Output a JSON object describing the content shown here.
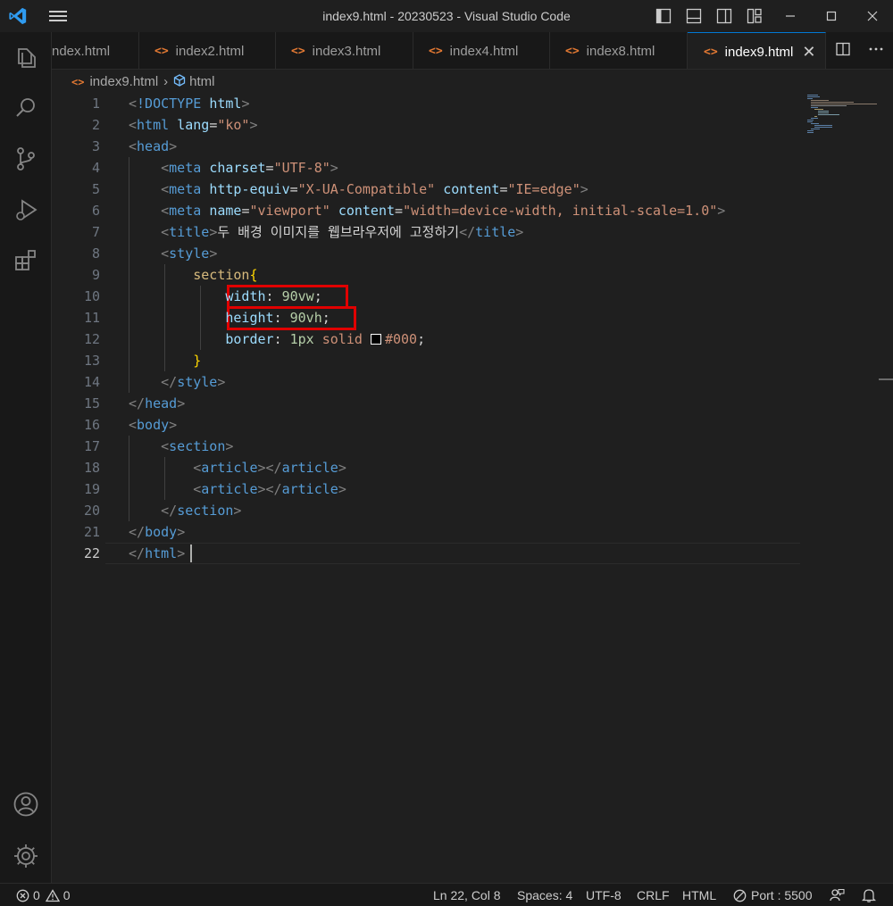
{
  "window": {
    "title": "index9.html - 20230523 - Visual Studio Code"
  },
  "tabs": [
    {
      "label": "index.html",
      "shown": "ndex.html",
      "active": false
    },
    {
      "label": "index2.html",
      "active": false
    },
    {
      "label": "index3.html",
      "active": false
    },
    {
      "label": "index4.html",
      "active": false
    },
    {
      "label": "index8.html",
      "active": false
    },
    {
      "label": "index9.html",
      "active": true
    }
  ],
  "tab_icon": "<>",
  "breadcrumb": {
    "file": "index9.html",
    "symbol": "html"
  },
  "editor": {
    "line_numbers": [
      "1",
      "2",
      "3",
      "4",
      "5",
      "6",
      "7",
      "8",
      "9",
      "10",
      "11",
      "12",
      "13",
      "14",
      "15",
      "16",
      "17",
      "18",
      "19",
      "20",
      "21",
      "22"
    ],
    "current_line": 22,
    "lines": [
      [
        [
          "p",
          "<"
        ],
        [
          "t",
          "!DOCTYPE"
        ],
        [
          "w",
          " "
        ],
        [
          "a",
          "html"
        ],
        [
          "p",
          ">"
        ]
      ],
      [
        [
          "p",
          "<"
        ],
        [
          "t",
          "html"
        ],
        [
          "w",
          " "
        ],
        [
          "a",
          "lang"
        ],
        [
          "w",
          "="
        ],
        [
          "s",
          "\"ko\""
        ],
        [
          "p",
          ">"
        ]
      ],
      [
        [
          "p",
          "<"
        ],
        [
          "t",
          "head"
        ],
        [
          "p",
          ">"
        ]
      ],
      [
        [
          "w",
          "    "
        ],
        [
          "p",
          "<"
        ],
        [
          "t",
          "meta"
        ],
        [
          "w",
          " "
        ],
        [
          "a",
          "charset"
        ],
        [
          "w",
          "="
        ],
        [
          "s",
          "\"UTF-8\""
        ],
        [
          "p",
          ">"
        ]
      ],
      [
        [
          "w",
          "    "
        ],
        [
          "p",
          "<"
        ],
        [
          "t",
          "meta"
        ],
        [
          "w",
          " "
        ],
        [
          "a",
          "http-equiv"
        ],
        [
          "w",
          "="
        ],
        [
          "s",
          "\"X-UA-Compatible\""
        ],
        [
          "w",
          " "
        ],
        [
          "a",
          "content"
        ],
        [
          "w",
          "="
        ],
        [
          "s",
          "\"IE=edge\""
        ],
        [
          "p",
          ">"
        ]
      ],
      [
        [
          "w",
          "    "
        ],
        [
          "p",
          "<"
        ],
        [
          "t",
          "meta"
        ],
        [
          "w",
          " "
        ],
        [
          "a",
          "name"
        ],
        [
          "w",
          "="
        ],
        [
          "s",
          "\"viewport\""
        ],
        [
          "w",
          " "
        ],
        [
          "a",
          "content"
        ],
        [
          "w",
          "="
        ],
        [
          "s",
          "\"width=device-width, initial-scale=1.0\""
        ],
        [
          "p",
          ">"
        ]
      ],
      [
        [
          "w",
          "    "
        ],
        [
          "p",
          "<"
        ],
        [
          "t",
          "title"
        ],
        [
          "p",
          ">"
        ],
        [
          "w",
          "두 배경 이미지를 웹브라우저에 고정하기"
        ],
        [
          "p",
          "</"
        ],
        [
          "t",
          "title"
        ],
        [
          "p",
          ">"
        ]
      ],
      [
        [
          "w",
          "    "
        ],
        [
          "p",
          "<"
        ],
        [
          "t",
          "style"
        ],
        [
          "p",
          ">"
        ]
      ],
      [
        [
          "w",
          "        "
        ],
        [
          "sel",
          "section"
        ],
        [
          "br",
          "{"
        ]
      ],
      [
        [
          "w",
          "            "
        ],
        [
          "a",
          "width"
        ],
        [
          "w",
          ": "
        ],
        [
          "n",
          "90vw"
        ],
        [
          "w",
          ";"
        ]
      ],
      [
        [
          "w",
          "            "
        ],
        [
          "a",
          "height"
        ],
        [
          "w",
          ": "
        ],
        [
          "n",
          "90vh"
        ],
        [
          "w",
          ";"
        ]
      ],
      [
        [
          "w",
          "            "
        ],
        [
          "a",
          "border"
        ],
        [
          "w",
          ": "
        ],
        [
          "n",
          "1px"
        ],
        [
          "w",
          " "
        ],
        [
          "s",
          "solid"
        ],
        [
          "w",
          " "
        ],
        [
          "swatch",
          ""
        ],
        [
          "s",
          "#000"
        ],
        [
          "w",
          ";"
        ]
      ],
      [
        [
          "w",
          "        "
        ],
        [
          "br",
          "}"
        ]
      ],
      [
        [
          "w",
          "    "
        ],
        [
          "p",
          "</"
        ],
        [
          "t",
          "style"
        ],
        [
          "p",
          ">"
        ]
      ],
      [
        [
          "p",
          "</"
        ],
        [
          "t",
          "head"
        ],
        [
          "p",
          ">"
        ]
      ],
      [
        [
          "p",
          "<"
        ],
        [
          "t",
          "body"
        ],
        [
          "p",
          ">"
        ]
      ],
      [
        [
          "w",
          "    "
        ],
        [
          "p",
          "<"
        ],
        [
          "t",
          "section"
        ],
        [
          "p",
          ">"
        ]
      ],
      [
        [
          "w",
          "        "
        ],
        [
          "p",
          "<"
        ],
        [
          "t",
          "article"
        ],
        [
          "p",
          "></"
        ],
        [
          "t",
          "article"
        ],
        [
          "p",
          ">"
        ]
      ],
      [
        [
          "w",
          "        "
        ],
        [
          "p",
          "<"
        ],
        [
          "t",
          "article"
        ],
        [
          "p",
          "></"
        ],
        [
          "t",
          "article"
        ],
        [
          "p",
          ">"
        ]
      ],
      [
        [
          "w",
          "    "
        ],
        [
          "p",
          "</"
        ],
        [
          "t",
          "section"
        ],
        [
          "p",
          ">"
        ]
      ],
      [
        [
          "p",
          "</"
        ],
        [
          "t",
          "body"
        ],
        [
          "p",
          ">"
        ]
      ],
      [
        [
          "p",
          "</"
        ],
        [
          "t",
          "html"
        ],
        [
          "p",
          ">"
        ]
      ]
    ]
  },
  "colors": {
    "accent": "#0078d4",
    "highlight_box": "#e00000",
    "html_icon": "#e37933"
  },
  "status": {
    "errors": "0",
    "warnings": "0",
    "position": "Ln 22, Col 8",
    "spaces": "Spaces: 4",
    "encoding": "UTF-8",
    "eol": "CRLF",
    "language": "HTML",
    "port": "Port : 5500"
  },
  "icons": {
    "activity": [
      "explorer-icon",
      "search-icon",
      "source-control-icon",
      "run-debug-icon",
      "extensions-icon",
      "account-icon",
      "gear-icon"
    ]
  }
}
